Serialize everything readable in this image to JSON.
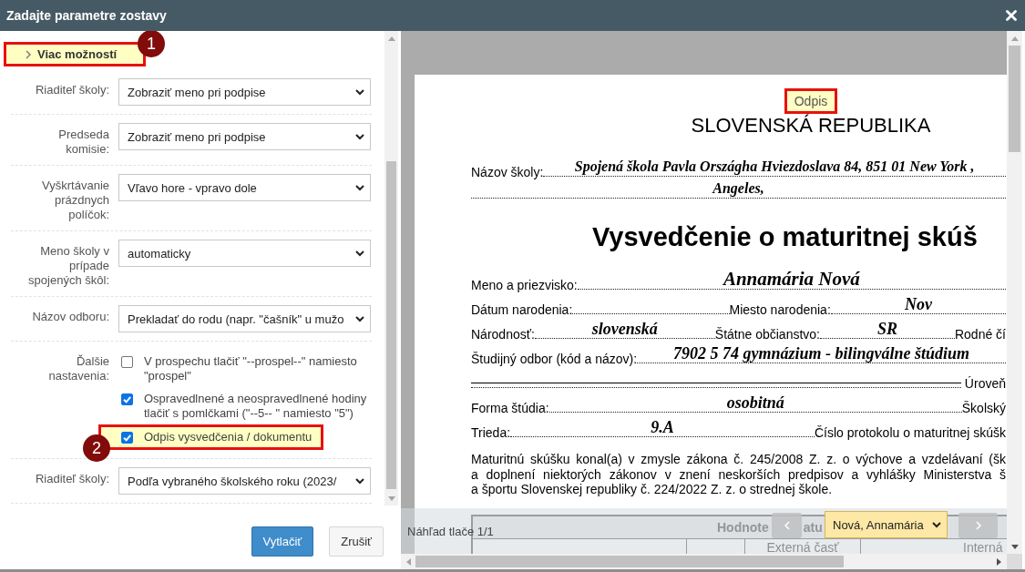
{
  "window": {
    "title": "Zadajte parametre zostavy"
  },
  "options_panel": {
    "more_options": {
      "label": "Viac možností",
      "expanded": false,
      "highlighted": true,
      "callout": "1"
    },
    "fields": [
      {
        "kind": "select",
        "label": "Riaditeľ školy:",
        "value": "Zobraziť meno pri podpise"
      },
      {
        "kind": "select",
        "label": "Predseda komisie:",
        "value": "Zobraziť meno pri podpise"
      },
      {
        "kind": "select",
        "label": "Vyškrtávanie prázdnych políčok:",
        "value": "Vľavo hore - vpravo dole"
      },
      {
        "kind": "select",
        "label": "Meno školy v prípade spojených škôl:",
        "value": "automaticky"
      },
      {
        "kind": "select",
        "label": "Názov odboru:",
        "value": "Prekladať do rodu (napr. \"čašník\" u mužo"
      },
      {
        "kind": "checkboxes",
        "label": "Ďalšie nastavenia:",
        "options": [
          {
            "label": "V prospechu tlačiť \"--prospel--\" namiesto \"prospel\"",
            "checked": false,
            "highlighted": false
          },
          {
            "label": "Ospravedlnené a neospravedlnené hodiny tlačiť s pomlčkami (\"--5-- \" namiesto \"5\")",
            "checked": true,
            "highlighted": false
          },
          {
            "label": "Odpis vysvedčenia / dokumentu",
            "checked": true,
            "highlighted": true,
            "callout": "2"
          }
        ]
      },
      {
        "kind": "select",
        "label": "Riaditeľ školy:",
        "value": "Podľa vybraného školského roku (2023/"
      }
    ]
  },
  "buttons": [
    {
      "label": "Vytlačiť",
      "primary": true
    },
    {
      "label": "Zrušiť",
      "primary": false
    }
  ],
  "preview": {
    "document": {
      "stamp": {
        "text": "Odpis",
        "highlighted": true
      },
      "country": "SLOVENSKÁ REPUBLIKA",
      "school": {
        "label": "Názov školy:",
        "value_lines": [
          "Spojená škola Pavla Országha Hviezdoslava 84, 851 01 New York ,",
          "Angeles,"
        ]
      },
      "title": "Vysvedčenie o maturitnej skúš",
      "rows": [
        {
          "segments": [
            {
              "kind": "field",
              "label": "Meno a priezvisko:",
              "value": "Annamária Nová"
            }
          ]
        },
        {
          "segments": [
            {
              "kind": "field",
              "label": "Dátum narodenia:"
            },
            {
              "kind": "field",
              "label": "Miesto narodenia:",
              "value": "Nov"
            }
          ]
        },
        {
          "segments": [
            {
              "kind": "field",
              "label": "Národnosť:",
              "value": "slovenská"
            },
            {
              "kind": "field",
              "label": "Štátne občianstvo:",
              "value": "SR"
            },
            {
              "kind": "label",
              "label": "Rodné čí"
            }
          ]
        },
        {
          "segments": [
            {
              "kind": "field",
              "label": "Študijný odbor (kód a názov):",
              "value": "7902 5 74 gymnázium - bilingválne štúdium"
            }
          ]
        },
        {
          "segments": [
            {
              "kind": "continuation",
              "label": "Úroveň"
            }
          ]
        },
        {
          "segments": [
            {
              "kind": "field",
              "label": "Forma štúdia:",
              "value": "osobitná"
            },
            {
              "kind": "label",
              "label": "Školský"
            }
          ]
        },
        {
          "segments": [
            {
              "kind": "field",
              "label": "Trieda:",
              "value": "9.A"
            },
            {
              "kind": "label",
              "label": "Číslo protokolu o maturitnej skúšk"
            }
          ]
        }
      ],
      "paragraph_lines": [
        "Maturitnú skúšku konal(a) v zmysle zákona č. 245/2008 Z. z. o výchove a vzdelávaní (šk",
        "a doplnení niektorých zákonov v znení neskorších predpisov a vyhlášky Ministerstva š",
        "a športu Slovenskej republiky č. 224/2022 Z. z. o strednej škole."
      ],
      "grades_table": {
        "title_parts": [
          "Hodnote",
          "atu"
        ],
        "subheaders": [
          "Externá časť",
          "Interná"
        ]
      }
    },
    "toolbar": {
      "page_info": "Náhľad tlače 1/1",
      "student": "Nová, Annamária"
    }
  }
}
